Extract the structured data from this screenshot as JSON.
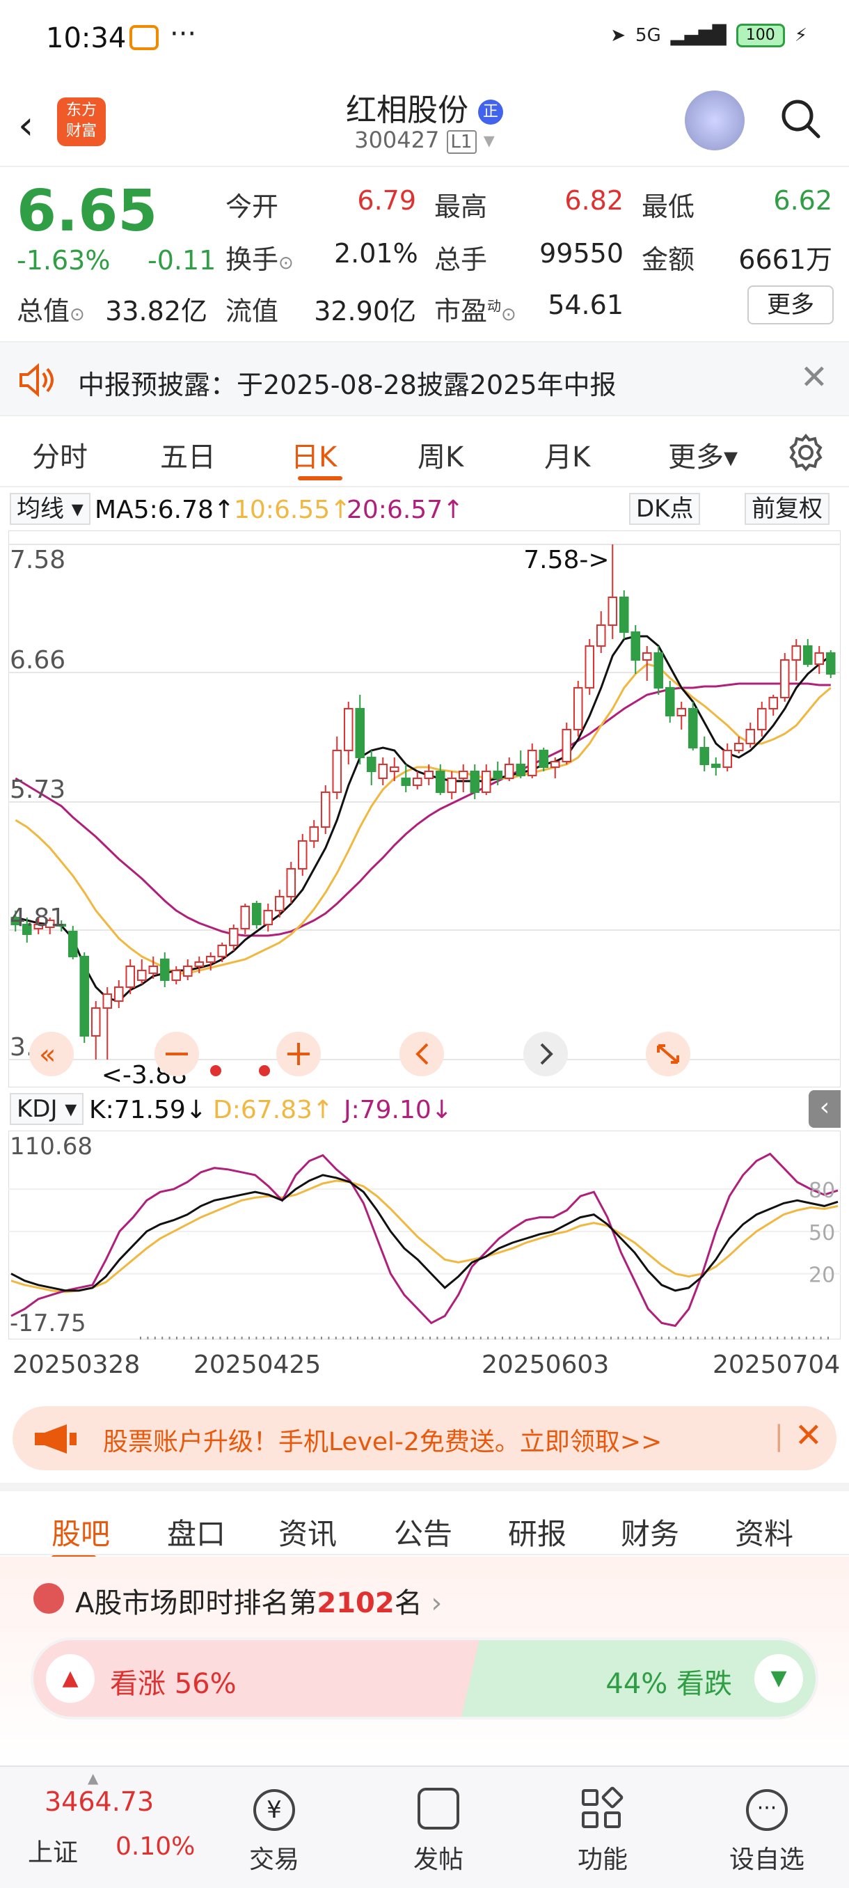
{
  "status_bar": {
    "time": "10:34",
    "more": "···",
    "network": "5G",
    "battery": "100"
  },
  "header": {
    "stock_name": "红相股份",
    "badge": "正",
    "code": "300427",
    "level": "L1",
    "logo_line1": "东方",
    "logo_line2": "财富"
  },
  "quote": {
    "price": "6.65",
    "change_pct": "-1.63%",
    "change": "-0.11",
    "open_label": "今开",
    "open": "6.79",
    "high_label": "最高",
    "high": "6.82",
    "low_label": "最低",
    "low": "6.62",
    "turnover_label": "换手",
    "turnover": "2.01%",
    "volume_label": "总手",
    "volume": "99550",
    "amount_label": "金额",
    "amount": "6661万",
    "mktcap_label": "总值",
    "mktcap": "33.82亿",
    "float_label": "流值",
    "float_cap": "32.90亿",
    "pe_label": "市盈",
    "pe_sup": "动",
    "pe": "54.61",
    "more_label": "更多"
  },
  "notice": {
    "text": "中报预披露：于2025-08-28披露2025年中报"
  },
  "tabs": [
    {
      "label": "分时"
    },
    {
      "label": "五日"
    },
    {
      "label": "日K"
    },
    {
      "label": "周K"
    },
    {
      "label": "月K"
    },
    {
      "label": "更多▾"
    }
  ],
  "ma": {
    "selector": "均线 ▾",
    "ma5": "MA5:6.78↑",
    "ma10": "10:6.55↑",
    "ma20": "20:6.57↑",
    "dk": "DK点",
    "adjust": "前复权"
  },
  "colors": {
    "up": "#e03131",
    "down": "#2f9e44",
    "ma5": "#111111",
    "ma10": "#f0b840",
    "ma20": "#b0207a",
    "accent": "#e8590c"
  },
  "chart_data": [
    {
      "type": "candlestick",
      "yticks": [
        "7.58",
        "6.66",
        "5.73",
        "4.81",
        "3.88"
      ],
      "ylim": [
        3.88,
        7.58
      ],
      "annotations": [
        "7.58->",
        "<-3.88"
      ],
      "candles": [
        [
          4.9,
          4.95,
          4.8,
          4.85
        ],
        [
          4.85,
          4.9,
          4.72,
          4.78
        ],
        [
          4.82,
          4.9,
          4.78,
          4.85
        ],
        [
          4.83,
          4.9,
          4.78,
          4.88
        ],
        [
          4.85,
          4.88,
          4.8,
          4.84
        ],
        [
          4.8,
          4.84,
          4.6,
          4.62
        ],
        [
          4.62,
          4.65,
          4.0,
          4.05
        ],
        [
          4.05,
          4.3,
          3.88,
          4.25
        ],
        [
          4.25,
          4.4,
          3.88,
          4.35
        ],
        [
          4.3,
          4.45,
          4.25,
          4.4
        ],
        [
          4.4,
          4.6,
          4.35,
          4.55
        ],
        [
          4.45,
          4.6,
          4.42,
          4.52
        ],
        [
          4.5,
          4.62,
          4.46,
          4.55
        ],
        [
          4.6,
          4.65,
          4.4,
          4.45
        ],
        [
          4.45,
          4.55,
          4.42,
          4.52
        ],
        [
          4.48,
          4.6,
          4.45,
          4.55
        ],
        [
          4.55,
          4.62,
          4.5,
          4.58
        ],
        [
          4.58,
          4.65,
          4.52,
          4.62
        ],
        [
          4.62,
          4.72,
          4.58,
          4.7
        ],
        [
          4.7,
          4.85,
          4.66,
          4.82
        ],
        [
          4.82,
          5.0,
          4.78,
          4.98
        ],
        [
          5.0,
          5.02,
          4.82,
          4.85
        ],
        [
          4.85,
          5.0,
          4.8,
          4.95
        ],
        [
          4.95,
          5.1,
          4.9,
          5.05
        ],
        [
          5.05,
          5.3,
          5.0,
          5.25
        ],
        [
          5.25,
          5.5,
          5.2,
          5.45
        ],
        [
          5.45,
          5.6,
          5.4,
          5.55
        ],
        [
          5.55,
          5.85,
          5.5,
          5.8
        ],
        [
          5.8,
          6.2,
          5.75,
          6.1
        ],
        [
          6.1,
          6.45,
          6.0,
          6.4
        ],
        [
          6.4,
          6.5,
          6.0,
          6.05
        ],
        [
          6.05,
          6.1,
          5.85,
          5.95
        ],
        [
          5.9,
          6.05,
          5.85,
          6.0
        ],
        [
          5.95,
          6.05,
          5.88,
          5.98
        ],
        [
          5.9,
          6.0,
          5.8,
          5.85
        ],
        [
          5.85,
          5.95,
          5.82,
          5.9
        ],
        [
          5.9,
          6.0,
          5.85,
          5.95
        ],
        [
          5.95,
          6.0,
          5.78,
          5.8
        ],
        [
          5.8,
          5.95,
          5.75,
          5.9
        ],
        [
          5.9,
          6.0,
          5.8,
          5.95
        ],
        [
          5.95,
          6.0,
          5.75,
          5.8
        ],
        [
          5.8,
          6.0,
          5.78,
          5.95
        ],
        [
          5.95,
          6.02,
          5.85,
          5.9
        ],
        [
          5.9,
          6.05,
          5.88,
          6.0
        ],
        [
          6.0,
          6.1,
          5.9,
          5.92
        ],
        [
          5.92,
          6.15,
          5.9,
          6.1
        ],
        [
          6.1,
          6.12,
          5.95,
          5.98
        ],
        [
          5.98,
          6.05,
          5.9,
          6.02
        ],
        [
          6.02,
          6.3,
          6.0,
          6.25
        ],
        [
          6.25,
          6.6,
          6.2,
          6.55
        ],
        [
          6.55,
          6.9,
          6.5,
          6.85
        ],
        [
          6.85,
          7.1,
          6.8,
          7.0
        ],
        [
          7.0,
          7.58,
          6.9,
          7.2
        ],
        [
          7.2,
          7.25,
          6.9,
          6.95
        ],
        [
          6.95,
          7.0,
          6.65,
          6.75
        ],
        [
          6.75,
          6.85,
          6.6,
          6.8
        ],
        [
          6.8,
          6.85,
          6.5,
          6.55
        ],
        [
          6.55,
          6.6,
          6.3,
          6.35
        ],
        [
          6.35,
          6.45,
          6.25,
          6.4
        ],
        [
          6.4,
          6.45,
          6.1,
          6.12
        ],
        [
          6.12,
          6.2,
          5.95,
          6.0
        ],
        [
          6.0,
          6.05,
          5.92,
          5.98
        ],
        [
          5.98,
          6.15,
          5.95,
          6.1
        ],
        [
          6.1,
          6.2,
          6.08,
          6.15
        ],
        [
          6.15,
          6.3,
          6.12,
          6.25
        ],
        [
          6.25,
          6.45,
          6.2,
          6.4
        ],
        [
          6.4,
          6.5,
          6.35,
          6.48
        ],
        [
          6.48,
          6.8,
          6.45,
          6.75
        ],
        [
          6.75,
          6.9,
          6.6,
          6.85
        ],
        [
          6.85,
          6.9,
          6.7,
          6.72
        ],
        [
          6.72,
          6.85,
          6.65,
          6.8
        ],
        [
          6.8,
          6.82,
          6.62,
          6.65
        ]
      ],
      "ma5": [
        4.9,
        4.88,
        4.86,
        4.85,
        4.84,
        4.75,
        4.55,
        4.4,
        4.32,
        4.3,
        4.38,
        4.42,
        4.48,
        4.5,
        4.52,
        4.52,
        4.54,
        4.56,
        4.6,
        4.66,
        4.74,
        4.8,
        4.86,
        4.92,
        5.0,
        5.1,
        5.25,
        5.4,
        5.6,
        5.85,
        6.05,
        6.1,
        6.12,
        6.1,
        6.0,
        5.95,
        5.92,
        5.9,
        5.88,
        5.88,
        5.88,
        5.88,
        5.9,
        5.92,
        5.94,
        5.96,
        6.0,
        6.02,
        6.06,
        6.18,
        6.35,
        6.55,
        6.78,
        6.9,
        6.92,
        6.92,
        6.85,
        6.7,
        6.55,
        6.45,
        6.3,
        6.15,
        6.08,
        6.05,
        6.1,
        6.18,
        6.28,
        6.4,
        6.55,
        6.65,
        6.72,
        6.78
      ],
      "ma10": [
        5.6,
        5.55,
        5.48,
        5.4,
        5.3,
        5.2,
        5.08,
        4.95,
        4.85,
        4.75,
        4.68,
        4.62,
        4.58,
        4.54,
        4.5,
        4.5,
        4.52,
        4.54,
        4.56,
        4.58,
        4.6,
        4.64,
        4.68,
        4.72,
        4.78,
        4.86,
        4.96,
        5.08,
        5.22,
        5.38,
        5.55,
        5.7,
        5.82,
        5.9,
        5.95,
        5.98,
        5.98,
        5.96,
        5.95,
        5.94,
        5.92,
        5.9,
        5.9,
        5.9,
        5.92,
        5.94,
        5.96,
        5.98,
        6.0,
        6.05,
        6.15,
        6.28,
        6.4,
        6.55,
        6.65,
        6.72,
        6.7,
        6.62,
        6.55,
        6.48,
        6.42,
        6.35,
        6.28,
        6.2,
        6.15,
        6.15,
        6.18,
        6.22,
        6.28,
        6.38,
        6.48,
        6.55
      ],
      "ma20": [
        5.9,
        5.85,
        5.8,
        5.75,
        5.7,
        5.62,
        5.55,
        5.48,
        5.4,
        5.32,
        5.25,
        5.18,
        5.1,
        5.02,
        4.95,
        4.9,
        4.86,
        4.83,
        4.8,
        4.78,
        4.77,
        4.77,
        4.77,
        4.78,
        4.8,
        4.84,
        4.88,
        4.93,
        5.0,
        5.08,
        5.16,
        5.25,
        5.33,
        5.42,
        5.5,
        5.57,
        5.63,
        5.68,
        5.72,
        5.76,
        5.8,
        5.84,
        5.88,
        5.92,
        5.96,
        6.0,
        6.04,
        6.08,
        6.12,
        6.17,
        6.22,
        6.28,
        6.34,
        6.4,
        6.45,
        6.5,
        6.52,
        6.54,
        6.55,
        6.55,
        6.56,
        6.56,
        6.57,
        6.58,
        6.58,
        6.58,
        6.58,
        6.58,
        6.58,
        6.58,
        6.57,
        6.57
      ]
    },
    {
      "type": "line",
      "title": "KDJ",
      "legend": {
        "selector": "KDJ ▾",
        "k": "K:71.59↓",
        "d": "D:67.83↑",
        "j": "J:79.10↓"
      },
      "yticks": [
        "110.68",
        "-17.75"
      ],
      "inner_ticks": [
        "80",
        "50",
        "20"
      ],
      "ylim": [
        -17.75,
        110.68
      ],
      "x": [
        "20250328",
        "20250425",
        "20250603",
        "20250704"
      ],
      "K": [
        20,
        15,
        12,
        10,
        8,
        8,
        10,
        18,
        30,
        40,
        50,
        55,
        58,
        62,
        68,
        72,
        74,
        76,
        78,
        76,
        72,
        80,
        86,
        90,
        88,
        85,
        78,
        65,
        50,
        38,
        30,
        20,
        10,
        18,
        28,
        32,
        38,
        42,
        45,
        48,
        50,
        55,
        60,
        62,
        55,
        45,
        35,
        22,
        12,
        8,
        10,
        18,
        30,
        45,
        55,
        62,
        66,
        70,
        72,
        70,
        68,
        71
      ],
      "D": [
        15,
        12,
        10,
        8,
        7,
        8,
        10,
        14,
        22,
        30,
        38,
        45,
        50,
        55,
        60,
        64,
        68,
        72,
        74,
        75,
        74,
        76,
        80,
        84,
        86,
        85,
        82,
        75,
        66,
        56,
        46,
        38,
        30,
        28,
        30,
        32,
        35,
        38,
        42,
        45,
        48,
        50,
        54,
        56,
        54,
        48,
        42,
        34,
        26,
        20,
        18,
        20,
        25,
        33,
        42,
        50,
        56,
        62,
        65,
        67,
        66,
        68
      ],
      "J": [
        -10,
        -5,
        2,
        5,
        8,
        10,
        12,
        30,
        50,
        60,
        72,
        78,
        80,
        85,
        92,
        95,
        94,
        92,
        90,
        82,
        72,
        90,
        100,
        104,
        94,
        86,
        70,
        45,
        20,
        5,
        -5,
        -15,
        -10,
        5,
        25,
        35,
        45,
        52,
        58,
        60,
        60,
        65,
        75,
        78,
        60,
        35,
        15,
        -5,
        -15,
        -17,
        -5,
        20,
        50,
        75,
        90,
        100,
        105,
        95,
        85,
        80,
        76,
        79
      ]
    }
  ],
  "dates": [
    "20250328",
    "20250425",
    "20250603",
    "20250704"
  ],
  "promo": {
    "text": "股票账户升级！手机Level-2免费送。立即领取>>"
  },
  "sub_tabs": [
    {
      "label": "股吧"
    },
    {
      "label": "盘口"
    },
    {
      "label": "资讯"
    },
    {
      "label": "公告"
    },
    {
      "label": "研报"
    },
    {
      "label": "财务"
    },
    {
      "label": "资料"
    }
  ],
  "rank": {
    "prefix": "A股市场即时排名第",
    "number": "2102",
    "suffix": "名"
  },
  "sentiment": {
    "up_label": "看涨 56%",
    "down_label": "44% 看跌",
    "up_pct": 56,
    "down_pct": 44
  },
  "bottom_nav": {
    "index_value": "3464.73",
    "index_name": "上证",
    "index_change": "0.10%",
    "items": [
      {
        "label": "交易"
      },
      {
        "label": "发帖"
      },
      {
        "label": "功能"
      },
      {
        "label": "设自选"
      }
    ]
  }
}
